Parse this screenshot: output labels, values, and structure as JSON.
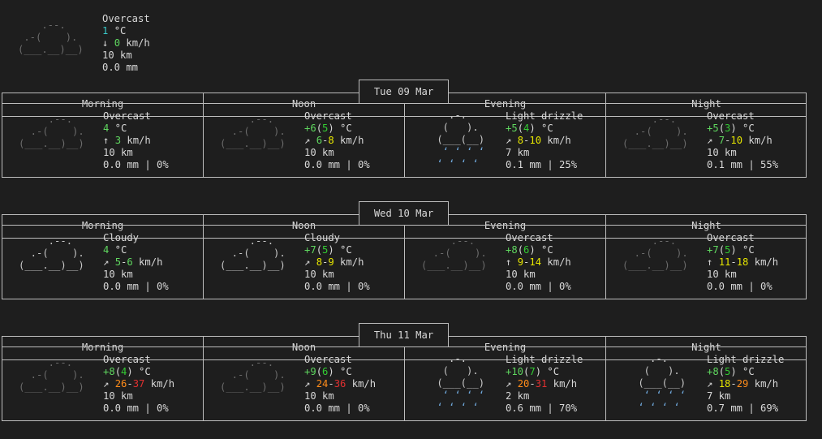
{
  "current": {
    "condition": "Overcast",
    "temp": "1",
    "temp_unit": "°C",
    "wind_arrow": "↓",
    "wind": "0",
    "wind_unit": "km/h",
    "visibility": "10 km",
    "precip": "0.0 mm"
  },
  "periods": [
    "Morning",
    "Noon",
    "Evening",
    "Night"
  ],
  "days": [
    {
      "date": "Tue 09 Mar",
      "cells": [
        {
          "icon": "overcast",
          "condition": "Overcast",
          "temp": "4",
          "temp_feel": "",
          "wind_arrow": "↑",
          "wind_lo": "3",
          "wind_hi": "",
          "visibility": "10 km",
          "precip": "0.0 mm | 0%"
        },
        {
          "icon": "overcast",
          "condition": "Overcast",
          "temp": "+6",
          "temp_feel": "5",
          "wind_arrow": "↗",
          "wind_lo": "6",
          "wind_hi": "8",
          "visibility": "10 km",
          "precip": "0.0 mm | 0%"
        },
        {
          "icon": "drizzle",
          "condition": "Light drizzle",
          "temp": "+5",
          "temp_feel": "4",
          "wind_arrow": "↗",
          "wind_lo": "8",
          "wind_hi": "10",
          "visibility": "7 km",
          "precip": "0.1 mm | 25%"
        },
        {
          "icon": "overcast",
          "condition": "Overcast",
          "temp": "+5",
          "temp_feel": "3",
          "wind_arrow": "↗",
          "wind_lo": "7",
          "wind_hi": "10",
          "visibility": "10 km",
          "precip": "0.1 mm | 55%"
        }
      ]
    },
    {
      "date": "Wed 10 Mar",
      "cells": [
        {
          "icon": "cloudy",
          "condition": "Cloudy",
          "temp": "4",
          "temp_feel": "",
          "wind_arrow": "↗",
          "wind_lo": "5",
          "wind_hi": "6",
          "visibility": "10 km",
          "precip": "0.0 mm | 0%"
        },
        {
          "icon": "cloudy",
          "condition": "Cloudy",
          "temp": "+7",
          "temp_feel": "5",
          "wind_arrow": "↗",
          "wind_lo": "8",
          "wind_hi": "9",
          "visibility": "10 km",
          "precip": "0.0 mm | 0%"
        },
        {
          "icon": "overcast",
          "condition": "Overcast",
          "temp": "+8",
          "temp_feel": "6",
          "wind_arrow": "↑",
          "wind_lo": "9",
          "wind_hi": "14",
          "visibility": "10 km",
          "precip": "0.0 mm | 0%"
        },
        {
          "icon": "overcast",
          "condition": "Overcast",
          "temp": "+7",
          "temp_feel": "5",
          "wind_arrow": "↑",
          "wind_lo": "11",
          "wind_hi": "18",
          "visibility": "10 km",
          "precip": "0.0 mm | 0%"
        }
      ]
    },
    {
      "date": "Thu 11 Mar",
      "cells": [
        {
          "icon": "overcast",
          "condition": "Overcast",
          "temp": "+8",
          "temp_feel": "4",
          "wind_arrow": "↗",
          "wind_lo": "26",
          "wind_hi": "37",
          "visibility": "10 km",
          "precip": "0.0 mm | 0%"
        },
        {
          "icon": "overcast",
          "condition": "Overcast",
          "temp": "+9",
          "temp_feel": "6",
          "wind_arrow": "↗",
          "wind_lo": "24",
          "wind_hi": "36",
          "visibility": "10 km",
          "precip": "0.0 mm | 0%"
        },
        {
          "icon": "drizzle",
          "condition": "Light drizzle",
          "temp": "+10",
          "temp_feel": "7",
          "wind_arrow": "↗",
          "wind_lo": "20",
          "wind_hi": "31",
          "visibility": "2 km",
          "precip": "0.6 mm | 70%"
        },
        {
          "icon": "drizzle",
          "condition": "Light drizzle",
          "temp": "+8",
          "temp_feel": "5",
          "wind_arrow": "↗",
          "wind_lo": "18",
          "wind_hi": "29",
          "visibility": "7 km",
          "precip": "0.7 mm | 69%"
        }
      ]
    }
  ]
}
